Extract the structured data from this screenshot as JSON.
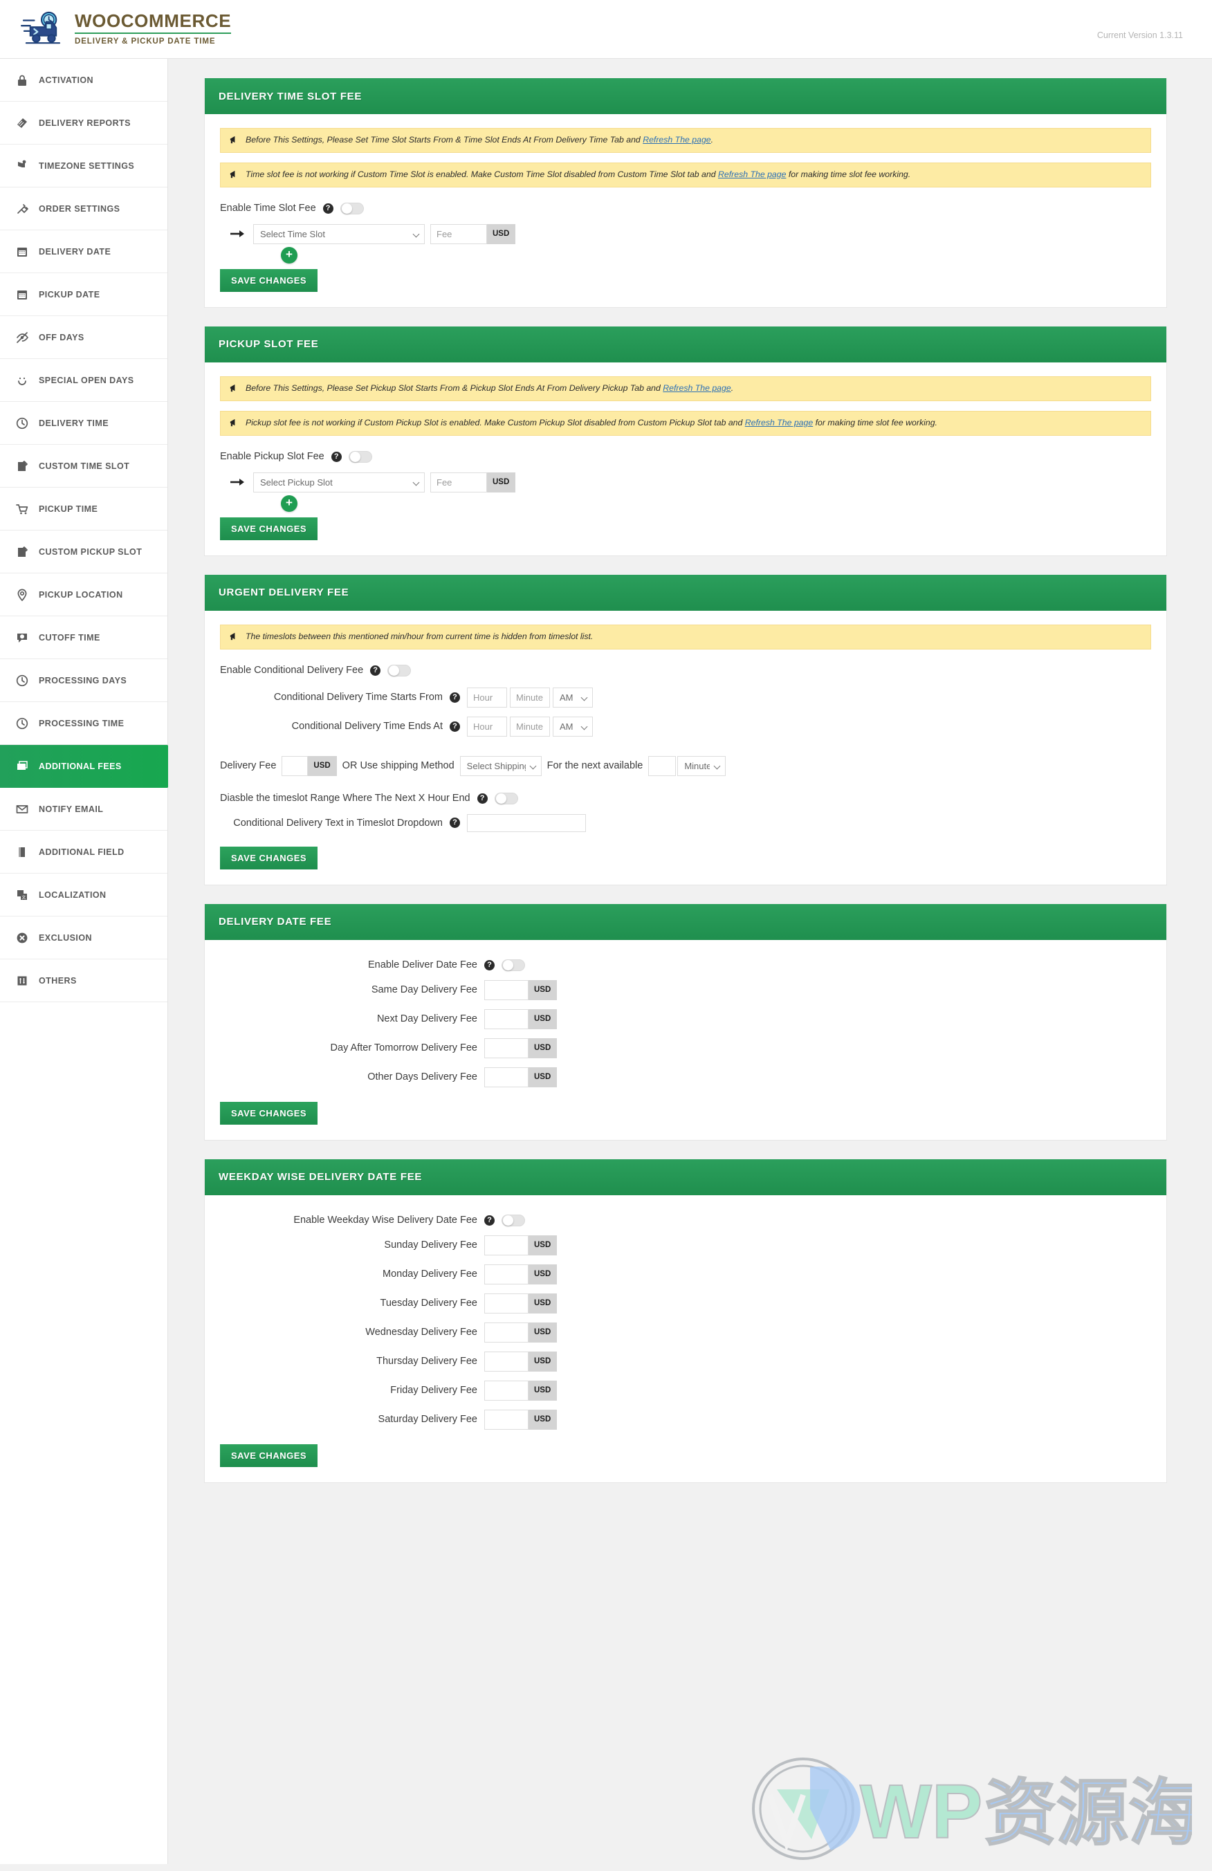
{
  "header": {
    "brand_title": "WOOCOMMERCE",
    "brand_subtitle": "DELIVERY & PICKUP DATE TIME",
    "version": "Current Version 1.3.11",
    "truck_icon": "delivery-truck-icon"
  },
  "sidebar": {
    "items": [
      {
        "label": "ACTIVATION",
        "icon": "lock-icon",
        "active": false
      },
      {
        "label": "DELIVERY REPORTS",
        "icon": "report-icon",
        "active": false
      },
      {
        "label": "TIMEZONE SETTINGS",
        "icon": "flag-map-icon",
        "active": false
      },
      {
        "label": "ORDER SETTINGS",
        "icon": "plug-icon",
        "active": false
      },
      {
        "label": "DELIVERY DATE",
        "icon": "calendar-icon",
        "active": false
      },
      {
        "label": "PICKUP DATE",
        "icon": "calendar-icon",
        "active": false
      },
      {
        "label": "OFF DAYS",
        "icon": "eye-slash-icon",
        "active": false
      },
      {
        "label": "SPECIAL OPEN DAYS",
        "icon": "smiley-icon",
        "active": false
      },
      {
        "label": "DELIVERY TIME",
        "icon": "clock-icon",
        "active": false
      },
      {
        "label": "CUSTOM TIME SLOT",
        "icon": "note-pencil-icon",
        "active": false
      },
      {
        "label": "PICKUP TIME",
        "icon": "cart-icon",
        "active": false
      },
      {
        "label": "CUSTOM PICKUP SLOT",
        "icon": "note-pencil-icon",
        "active": false
      },
      {
        "label": "PICKUP LOCATION",
        "icon": "map-pin-icon",
        "active": false
      },
      {
        "label": "CUTOFF TIME",
        "icon": "speech-clock-icon",
        "active": false
      },
      {
        "label": "PROCESSING DAYS",
        "icon": "clock-icon",
        "active": false
      },
      {
        "label": "PROCESSING TIME",
        "icon": "clock-icon",
        "active": false
      },
      {
        "label": "ADDITIONAL FEES",
        "icon": "images-icon",
        "active": true
      },
      {
        "label": "NOTIFY EMAIL",
        "icon": "envelope-icon",
        "active": false
      },
      {
        "label": "ADDITIONAL FIELD",
        "icon": "book-icon",
        "active": false
      },
      {
        "label": "LOCALIZATION",
        "icon": "translate-icon",
        "active": false
      },
      {
        "label": "EXCLUSION",
        "icon": "circle-x-icon",
        "active": false
      },
      {
        "label": "OTHERS",
        "icon": "sliders-icon",
        "active": false
      }
    ]
  },
  "common": {
    "save_label": "Save Changes",
    "usd": "USD",
    "help_glyph": "?",
    "plus_glyph": "+",
    "refresh_link": "Refresh The page"
  },
  "panels": {
    "time_slot_fee": {
      "title": "Delivery Time Slot Fee",
      "notice1_before": "Before This Settings, Please Set Time Slot Starts From & Time Slot Ends At From Delivery Time Tab and ",
      "notice1_link": "Refresh The page",
      "notice1_after": ".",
      "notice2_before": "Time slot fee is not working if Custom Time Slot is enabled. Make Custom Time Slot disabled from Custom Time Slot tab and ",
      "notice2_link": "Refresh The page",
      "notice2_after": " for making time slot fee working.",
      "enable_label": "Enable Time Slot Fee",
      "enable_state": "off",
      "slot_placeholder": "Select Time Slot",
      "fee_placeholder": "Fee",
      "currency": "USD"
    },
    "pickup_slot_fee": {
      "title": "Pickup Slot Fee",
      "notice1_before": "Before This Settings, Please Set Pickup Slot Starts From & Pickup Slot Ends At From Delivery Pickup Tab and ",
      "notice1_link": "Refresh The page",
      "notice1_after": ".",
      "notice2_before": "Pickup slot fee is not working if Custom Pickup Slot is enabled. Make Custom Pickup Slot disabled from Custom Pickup Slot tab and ",
      "notice2_link": "Refresh The page",
      "notice2_after": " for making time slot fee working.",
      "enable_label": "Enable Pickup Slot Fee",
      "enable_state": "off",
      "slot_placeholder": "Select Pickup Slot",
      "fee_placeholder": "Fee",
      "currency": "USD"
    },
    "urgent_delivery_fee": {
      "title": "Urgent Delivery Fee",
      "notice": "The timeslots between this mentioned min/hour from current time is hidden from timeslot list.",
      "enable_label": "Enable Conditional Delivery Fee",
      "enable_state": "off",
      "starts_label": "Conditional Delivery Time Starts From",
      "ends_label": "Conditional Delivery Time Ends At",
      "hour_placeholder": "Hour",
      "minute_placeholder": "Minute",
      "meridiem_value": "AM",
      "delivery_fee_label": "Delivery Fee",
      "currency": "USD",
      "or_label": "OR Use shipping Method",
      "shipping_method_value": "Select Shipping Method",
      "next_available_label": "For the next available",
      "minutes_value": "Minutes",
      "disable_range_label": "Diasble the timeslot Range Where The Next X Hour End",
      "disable_range_state": "off",
      "dropdown_text_label": "Conditional Delivery Text in Timeslot Dropdown",
      "dropdown_text_value": ""
    },
    "delivery_date_fee": {
      "title": "Delivery Date Fee",
      "enable_label": "Enable Deliver Date Fee",
      "enable_state": "off",
      "currency": "USD",
      "fields": [
        {
          "label": "Same Day Delivery Fee",
          "value": ""
        },
        {
          "label": "Next Day Delivery Fee",
          "value": ""
        },
        {
          "label": "Day After Tomorrow Delivery Fee",
          "value": ""
        },
        {
          "label": "Other Days Delivery Fee",
          "value": ""
        }
      ]
    },
    "weekday_fee": {
      "title": "Weekday Wise Delivery Date Fee",
      "enable_label": "Enable Weekday Wise Delivery Date Fee",
      "enable_state": "off",
      "currency": "USD",
      "fields": [
        {
          "label": "Sunday Delivery Fee",
          "value": ""
        },
        {
          "label": "Monday Delivery Fee",
          "value": ""
        },
        {
          "label": "Tuesday Delivery Fee",
          "value": ""
        },
        {
          "label": "Wednesday Delivery Fee",
          "value": ""
        },
        {
          "label": "Thursday Delivery Fee",
          "value": ""
        },
        {
          "label": "Friday Delivery Fee",
          "value": ""
        },
        {
          "label": "Saturday Delivery Fee",
          "value": ""
        }
      ]
    }
  },
  "watermark": {
    "text": "WP资源海",
    "logo": "wordpress-logo-icon"
  },
  "colors": {
    "brand_green": "#1f9d52",
    "header_green": "#2b9f5c",
    "notice_yellow": "#fdeba4",
    "link_blue": "#2b6fb5"
  }
}
